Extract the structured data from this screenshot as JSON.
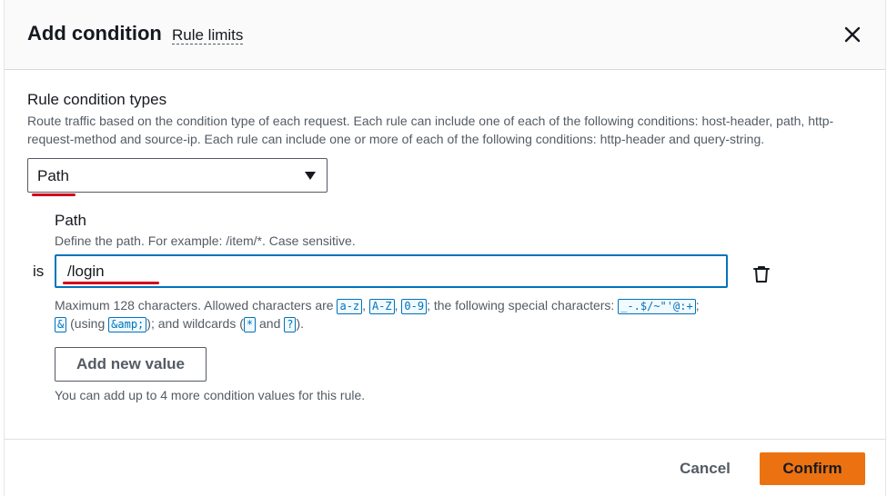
{
  "header": {
    "title": "Add condition",
    "rule_limits_link": "Rule limits",
    "close_icon": "close-icon"
  },
  "condition_types": {
    "label": "Rule condition types",
    "description": "Route traffic based on the condition type of each request. Each rule can include one of each of the following conditions: host-header, path, http-request-method and source-ip. Each rule can include one or more of each of the following conditions: http-header and query-string.",
    "selected": "Path"
  },
  "path": {
    "label": "Path",
    "description": "Define the path. For example: /item/*. Case sensitive.",
    "operator": "is",
    "value": "/login",
    "constraint_prefix": "Maximum 128 characters. Allowed characters are",
    "codes": [
      "a-z",
      "A-Z",
      "0-9",
      "_-.$/~\"'@:+",
      "&",
      "&amp;",
      "*",
      "?"
    ],
    "constraint_mid1": "; the following special characters:",
    "constraint_mid2": "(using",
    "constraint_mid3": "); and wildcards (",
    "constraint_and": "and",
    "constraint_end": ").",
    "delete_icon": "trash-icon"
  },
  "add_value": {
    "button_label": "Add new value",
    "hint": "You can add up to 4 more condition values for this rule."
  },
  "footer": {
    "cancel_label": "Cancel",
    "confirm_label": "Confirm"
  },
  "colors": {
    "primary": "#ec7211",
    "focus": "#0073bb",
    "annotation": "#d0021b"
  }
}
